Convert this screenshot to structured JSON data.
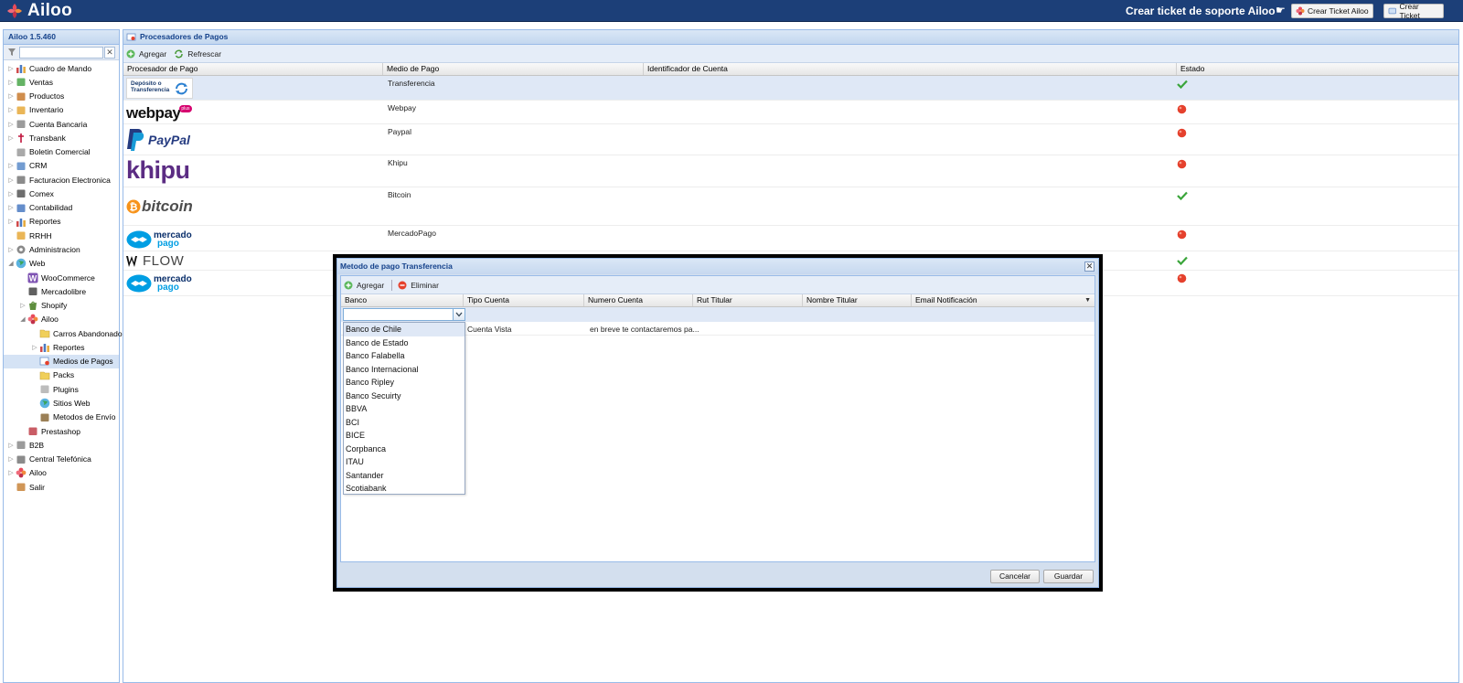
{
  "header": {
    "app_name": "Ailoo",
    "support_text": "Crear ticket de soporte Ailoo",
    "support_arrow": "☛",
    "btn_ailoo_ticket": "Crear Ticket Ailoo",
    "btn_ticket": "Crear Ticket"
  },
  "sidebar": {
    "version": "Ailoo 1.5.460",
    "filter_value": "",
    "filter_clear": "✕",
    "items": [
      {
        "label": "Cuadro de Mando",
        "icon": "chart-icon",
        "color": "#c84141"
      },
      {
        "label": "Ventas",
        "icon": "tag-icon",
        "color": "#4aa64a"
      },
      {
        "label": "Productos",
        "icon": "box-icon",
        "color": "#c87a2e"
      },
      {
        "label": "Inventario",
        "icon": "package-icon",
        "color": "#e6a93a"
      },
      {
        "label": "Cuenta Bancaria",
        "icon": "bank-icon",
        "color": "#8a8a8a"
      },
      {
        "label": "Transbank",
        "icon": "transbank-icon",
        "color": "#c0143c"
      },
      {
        "label": "Boletin Comercial",
        "icon": "tag-gray-icon",
        "color": "#9a9a9a"
      },
      {
        "label": "CRM",
        "icon": "users-icon",
        "color": "#5b8bc9"
      },
      {
        "label": "Facturacion Electronica",
        "icon": "invoice-icon",
        "color": "#777777"
      },
      {
        "label": "Comex",
        "icon": "truck-icon",
        "color": "#555555"
      },
      {
        "label": "Contabilidad",
        "icon": "calculator-icon",
        "color": "#4a7ac2"
      },
      {
        "label": "Reportes",
        "icon": "chart-icon",
        "color": "#3a6bc2"
      },
      {
        "label": "RRHH",
        "icon": "people-icon",
        "color": "#e6a93a"
      },
      {
        "label": "Administracion",
        "icon": "gear-icon",
        "color": "#8a8a8a"
      },
      {
        "label": "Web",
        "icon": "globe-icon",
        "color": "#3aa55a"
      },
      {
        "label": "WooCommerce",
        "icon": "woocommerce-icon",
        "color": "#7f54b3"
      },
      {
        "label": "Mercadolibre",
        "icon": "mercadolibre-icon",
        "color": "#444444"
      },
      {
        "label": "Shopify",
        "icon": "shopify-icon",
        "color": "#5e8e3e"
      },
      {
        "label": "Ailoo",
        "icon": "ailoo-icon",
        "color": "#d23c4c"
      },
      {
        "label": "Carros Abandonados",
        "icon": "folder-icon",
        "color": "#e8c34a"
      },
      {
        "label": "Reportes",
        "icon": "chart-icon",
        "color": "#3a6bc2"
      },
      {
        "label": "Medios de Pagos",
        "icon": "payment-icon",
        "color": "#6a8fc8"
      },
      {
        "label": "Packs",
        "icon": "folder-icon",
        "color": "#e8c34a"
      },
      {
        "label": "Plugins",
        "icon": "plugin-icon",
        "color": "#b0b0b0"
      },
      {
        "label": "Sitios Web",
        "icon": "globe-icon",
        "color": "#3aa55a"
      },
      {
        "label": "Metodos de Envío",
        "icon": "shipping-icon",
        "color": "#8a6a3a"
      },
      {
        "label": "Prestashop",
        "icon": "prestashop-icon",
        "color": "#c0404a"
      },
      {
        "label": "B2B",
        "icon": "building-icon",
        "color": "#8a8a8a"
      },
      {
        "label": "Central Telefónica",
        "icon": "phone-icon",
        "color": "#777777"
      },
      {
        "label": "Ailoo",
        "icon": "ailoo-icon",
        "color": "#d23c4c"
      },
      {
        "label": "Salir",
        "icon": "exit-icon",
        "color": "#c8843a"
      }
    ]
  },
  "main": {
    "title": "Procesadores de Pagos",
    "add_label": "Agregar",
    "refresh_label": "Refrescar",
    "columns": [
      "Procesador de Pago",
      "Medio de Pago",
      "Identificador de Cuenta",
      "Estado"
    ],
    "rows": [
      {
        "logo": "deposito-transferencia-logo",
        "logo_text_1": "Depósito o",
        "logo_text_2": "Transferencia",
        "medio": "Transferencia",
        "identificador": "",
        "status": "active",
        "status_icon": "check-icon"
      },
      {
        "logo": "webpay-logo",
        "logo_text_1": "webpay",
        "logo_text_2": "plus",
        "medio": "Webpay",
        "identificador": "",
        "status": "inactive",
        "status_icon": "red-dot-icon"
      },
      {
        "logo": "paypal-logo",
        "logo_text_1": "PayPal",
        "logo_text_2": "",
        "medio": "Paypal",
        "identificador": "",
        "status": "inactive",
        "status_icon": "red-dot-icon"
      },
      {
        "logo": "khipu-logo",
        "logo_text_1": "khipu",
        "logo_text_2": "",
        "medio": "Khipu",
        "identificador": "",
        "status": "inactive",
        "status_icon": "red-dot-icon"
      },
      {
        "logo": "bitcoin-logo",
        "logo_text_1": "bitcoin",
        "logo_text_2": "",
        "medio": "Bitcoin",
        "identificador": "",
        "status": "active",
        "status_icon": "check-icon"
      },
      {
        "logo": "mercadopago-logo",
        "logo_text_1": "mercado",
        "logo_text_2": "pago",
        "medio": "MercadoPago",
        "identificador": "",
        "status": "inactive",
        "status_icon": "red-dot-icon"
      },
      {
        "logo": "flow-logo",
        "logo_text_1": "FLOW",
        "logo_text_2": "",
        "medio": "",
        "identificador": "",
        "status": "active",
        "status_icon": "check-icon"
      },
      {
        "logo": "mercadopago-logo",
        "logo_text_1": "mercado",
        "logo_text_2": "pago",
        "medio": "",
        "identificador": "",
        "status": "inactive",
        "status_icon": "red-dot-icon"
      }
    ]
  },
  "modal": {
    "title": "Metodo de pago Transferencia",
    "close": "✕",
    "add_label": "Agregar",
    "delete_label": "Eliminar",
    "columns": [
      "Banco",
      "Tipo Cuenta",
      "Numero Cuenta",
      "Rut Titular",
      "Nombre Titular",
      "Email Notificación"
    ],
    "bank_value": "",
    "row": {
      "tipo_cuenta": "Cuenta Vista",
      "numero_cuenta": "en breve te contactaremos pa..."
    },
    "bank_options": [
      "Banco de Chile",
      "Banco de Estado",
      "Banco Falabella",
      "Banco Internacional",
      "Banco Ripley",
      "Banco Secuirty",
      "BBVA",
      "BCI",
      "BICE",
      "Corpbanca",
      "ITAU",
      "Santander",
      "Scotiabank"
    ],
    "cancel_label": "Cancelar",
    "save_label": "Guardar"
  },
  "colors": {
    "header_bg": "#1c3f78",
    "panel_title": "#15428b",
    "active": "#3aa53a",
    "inactive": "#e5412d"
  }
}
